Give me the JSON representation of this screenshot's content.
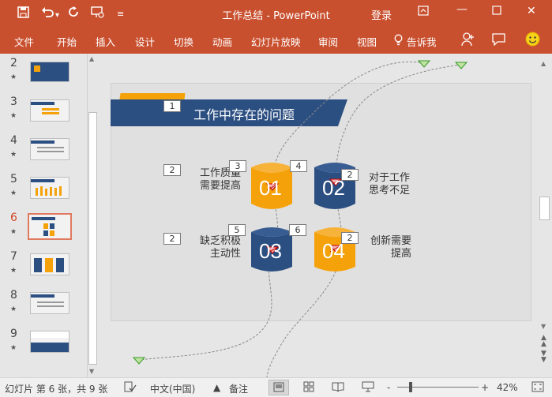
{
  "window": {
    "title": "工作总结  -  PowerPoint",
    "login": "登录",
    "quick_access": [
      "save-icon",
      "undo-icon",
      "redo-icon",
      "present-icon",
      "customize-icon"
    ]
  },
  "ribbon": {
    "tabs": [
      "文件",
      "开始",
      "插入",
      "设计",
      "切换",
      "动画",
      "幻灯片放映",
      "审阅",
      "视图"
    ],
    "tell_me": "告诉我"
  },
  "slides": [
    {
      "num": "2",
      "star": "★"
    },
    {
      "num": "3",
      "star": "★"
    },
    {
      "num": "4",
      "star": "★"
    },
    {
      "num": "5",
      "star": "★"
    },
    {
      "num": "6",
      "star": "★",
      "active": true
    },
    {
      "num": "7",
      "star": "★"
    },
    {
      "num": "8",
      "star": "★"
    },
    {
      "num": "9",
      "star": "★"
    }
  ],
  "slide": {
    "title": "工作中存在的问题",
    "title_anim": "1",
    "items": [
      {
        "label_l1": "工作质量",
        "label_l2": "需要提高",
        "num": "01",
        "box_label": "2",
        "box_cyl_l": "3",
        "box_cyl_r": "4"
      },
      {
        "label_l1": "对于工作",
        "label_l2": "思考不足",
        "num": "02",
        "box_label": "2"
      },
      {
        "label_l1": "缺乏积极",
        "label_l2": "主动性",
        "num": "03",
        "box_label": "2",
        "box_cyl_l": "5",
        "box_cyl_r": "6"
      },
      {
        "label_l1": "创新需要",
        "label_l2": "提高",
        "num": "04",
        "box_label": "2"
      }
    ],
    "colors": {
      "orange": "#f5a20a",
      "navy": "#2c4f82"
    }
  },
  "status": {
    "slide_info": "幻灯片 第 6 张，共 9 张",
    "language": "中文(中国)",
    "notes": "备注",
    "zoom": "42%",
    "zoom_minus": "-",
    "zoom_plus": "+"
  }
}
